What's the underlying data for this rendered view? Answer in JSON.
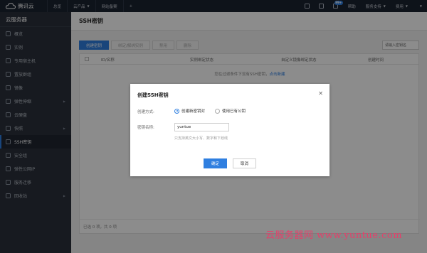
{
  "topbar": {
    "logo": "腾讯云",
    "nav": [
      {
        "label": "总览",
        "chevron": false
      },
      {
        "label": "云产品",
        "chevron": true
      },
      {
        "label": "网站备案",
        "chevron": false
      },
      {
        "label": "+",
        "chevron": false
      }
    ],
    "mail_badge": "99+",
    "help": "帮助",
    "support": "服务支持",
    "billing": "费用",
    "icons": [
      "monitor-icon",
      "document-icon",
      "mail-icon"
    ]
  },
  "sidebar": {
    "title": "云服务器",
    "items": [
      {
        "label": "概览",
        "icon": "overview-icon",
        "active": false,
        "chevron": false
      },
      {
        "label": "实例",
        "icon": "instance-icon",
        "active": false,
        "chevron": false
      },
      {
        "label": "专用宿主机",
        "icon": "host-icon",
        "active": false,
        "chevron": false
      },
      {
        "label": "置放群组",
        "icon": "group-icon",
        "active": false,
        "chevron": false
      },
      {
        "label": "镜像",
        "icon": "image-icon",
        "active": false,
        "chevron": false
      },
      {
        "label": "弹性伸缩",
        "icon": "scaling-icon",
        "active": false,
        "chevron": true
      },
      {
        "label": "云硬盘",
        "icon": "disk-icon",
        "active": false,
        "chevron": false
      },
      {
        "label": "快照",
        "icon": "snapshot-icon",
        "active": false,
        "chevron": true
      },
      {
        "label": "SSH密钥",
        "icon": "key-icon",
        "active": true,
        "chevron": false
      },
      {
        "label": "安全组",
        "icon": "shield-icon",
        "active": false,
        "chevron": false
      },
      {
        "label": "弹性公网IP",
        "icon": "eip-icon",
        "active": false,
        "chevron": false
      },
      {
        "label": "服务迁移",
        "icon": "migrate-icon",
        "active": false,
        "chevron": false
      },
      {
        "label": "回收站",
        "icon": "recycle-icon",
        "active": false,
        "chevron": true
      }
    ]
  },
  "main": {
    "title": "SSH密钥",
    "toolbar": {
      "create": "创建密钥",
      "bind": "绑定/解绑实例",
      "disable": "禁用",
      "delete": "删除"
    },
    "search_placeholder": "请输入密钥名",
    "columns": [
      "ID/名称",
      "实例绑定状态",
      "自定义镜像绑定状态",
      "创建时间"
    ],
    "empty_text": "您在过滤条件下没有SSH密钥，",
    "empty_link": "点击新建",
    "footer": "已选 0 项，共 0 项"
  },
  "modal": {
    "title": "创建SSH密钥",
    "method_label": "创建方式:",
    "options": [
      "创建新密钥对",
      "使用已有公钥"
    ],
    "selected_option": "创建新密钥对",
    "name_label": "密钥名称:",
    "name_value": "yuntue",
    "hint": "只支持英文大小写、数字和下划线",
    "ok": "确定",
    "cancel": "取消"
  },
  "watermark": "云服务器网 www.yuntue.com",
  "colors": {
    "accent": "#2f7fe0",
    "sidebar": "#2a303b",
    "topbar": "#1b2331",
    "watermark": "#e4406b"
  }
}
